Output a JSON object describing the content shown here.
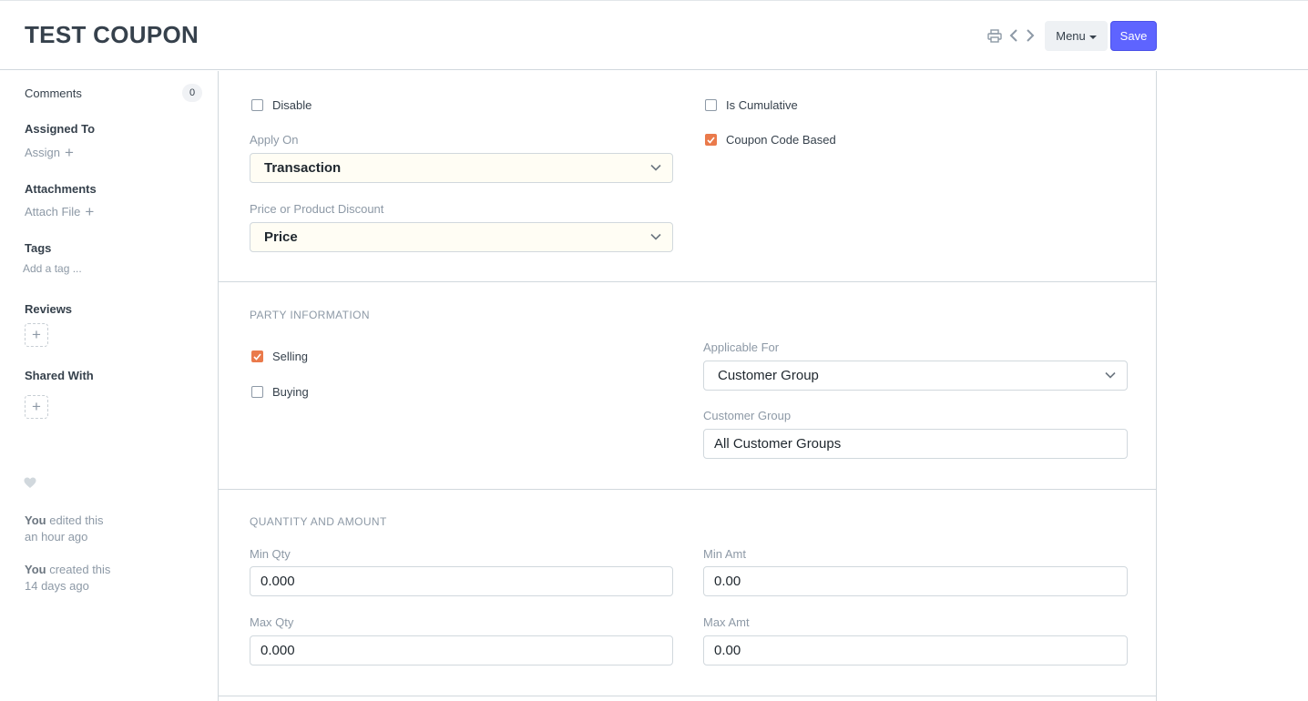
{
  "header": {
    "title": "TEST COUPON",
    "menu_label": "Menu",
    "save_label": "Save"
  },
  "sidebar": {
    "comments_label": "Comments",
    "comments_count": "0",
    "assigned_to_heading": "Assigned To",
    "assign_link": "Assign",
    "attachments_heading": "Attachments",
    "attach_link": "Attach File",
    "tags_heading": "Tags",
    "add_tag_link": "Add a tag ...",
    "reviews_heading": "Reviews",
    "shared_with_heading": "Shared With",
    "activity": [
      {
        "who": "You",
        "action": "edited this",
        "when": "an hour ago"
      },
      {
        "who": "You",
        "action": "created this",
        "when": "14 days ago"
      }
    ]
  },
  "form": {
    "disable": {
      "label": "Disable",
      "checked": false
    },
    "is_cumulative": {
      "label": "Is Cumulative",
      "checked": false
    },
    "coupon_code_based": {
      "label": "Coupon Code Based",
      "checked": true
    },
    "apply_on": {
      "label": "Apply On",
      "value": "Transaction"
    },
    "price_or_product_discount": {
      "label": "Price or Product Discount",
      "value": "Price"
    },
    "party_section_title": "PARTY INFORMATION",
    "selling": {
      "label": "Selling",
      "checked": true
    },
    "buying": {
      "label": "Buying",
      "checked": false
    },
    "applicable_for": {
      "label": "Applicable For",
      "value": "Customer Group"
    },
    "customer_group": {
      "label": "Customer Group",
      "value": "All Customer Groups"
    },
    "qty_section_title": "QUANTITY AND AMOUNT",
    "min_qty": {
      "label": "Min Qty",
      "value": "0.000"
    },
    "min_amt": {
      "label": "Min Amt",
      "value": "0.00"
    },
    "max_qty": {
      "label": "Max Qty",
      "value": "0.000"
    },
    "max_amt": {
      "label": "Max Amt",
      "value": "0.00"
    }
  },
  "colors": {
    "primary": "#5e64ff",
    "checkbox_checked": "#ea7a4b",
    "mandatory_bg": "#fffdf4"
  },
  "icons": {
    "print": "printer-icon",
    "prev": "chevron-left-icon",
    "next": "chevron-right-icon",
    "dropdown": "chevron-down-icon",
    "like": "heart-icon",
    "add": "plus-icon"
  }
}
